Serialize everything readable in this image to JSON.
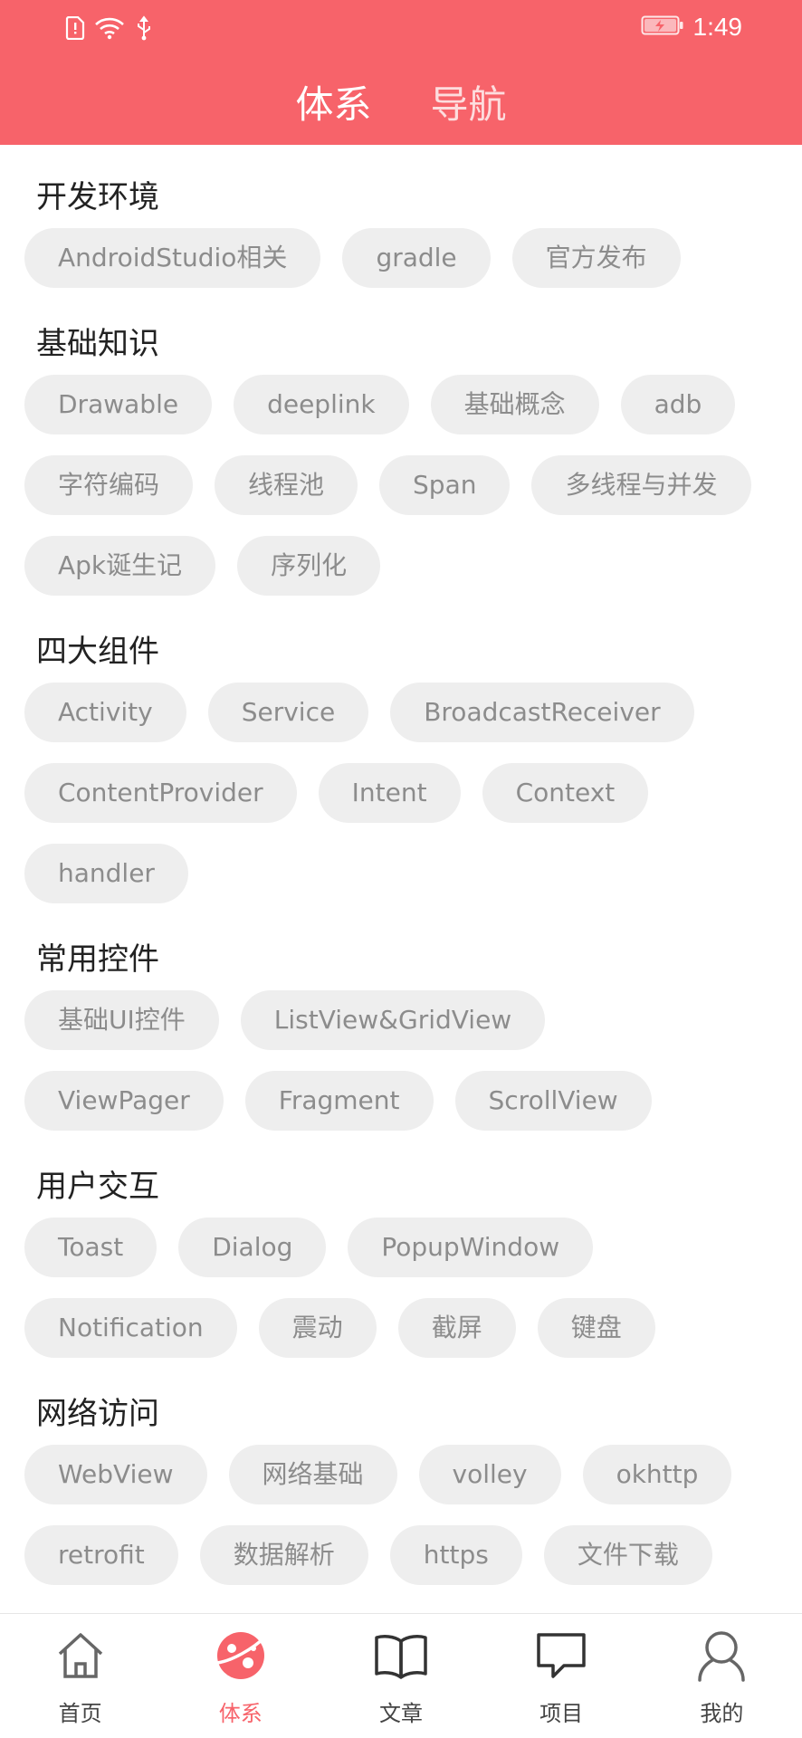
{
  "status_bar": {
    "time": "1:49",
    "icons": [
      "sim-alert-icon",
      "wifi-icon",
      "usb-icon",
      "battery-charging-icon"
    ]
  },
  "header": {
    "tabs": [
      {
        "label": "体系",
        "active": true
      },
      {
        "label": "导航",
        "active": false
      }
    ],
    "background_color": "#f7636a"
  },
  "sections": [
    {
      "title": "开发环境",
      "tags": [
        "AndroidStudio相关",
        "gradle",
        "官方发布"
      ]
    },
    {
      "title": "基础知识",
      "tags": [
        "Drawable",
        "deeplink",
        "基础概念",
        "adb",
        "字符编码",
        "线程池",
        "Span",
        "多线程与并发",
        "Apk诞生记",
        "序列化"
      ]
    },
    {
      "title": "四大组件",
      "tags": [
        "Activity",
        "Service",
        "BroadcastReceiver",
        "ContentProvider",
        "Intent",
        "Context",
        "handler"
      ]
    },
    {
      "title": "常用控件",
      "tags": [
        "基础UI控件",
        "ListView&GridView",
        "ViewPager",
        "Fragment",
        "ScrollView"
      ]
    },
    {
      "title": "用户交互",
      "tags": [
        "Toast",
        "Dialog",
        "PopupWindow",
        "Notification",
        "震动",
        "截屏",
        "键盘"
      ]
    },
    {
      "title": "网络访问",
      "tags": [
        "WebView",
        "网络基础",
        "volley",
        "okhttp",
        "retrofit",
        "数据解析",
        "https",
        "文件下载"
      ]
    }
  ],
  "bottom_nav": [
    {
      "label": "首页",
      "icon": "home-icon",
      "active": false
    },
    {
      "label": "体系",
      "icon": "system-planet-icon",
      "active": true
    },
    {
      "label": "文章",
      "icon": "book-icon",
      "active": false
    },
    {
      "label": "项目",
      "icon": "chat-bubble-icon",
      "active": false
    },
    {
      "label": "我的",
      "icon": "user-icon",
      "active": false
    }
  ],
  "colors": {
    "accent": "#f7636a",
    "chip_bg": "#eeeeee",
    "chip_text": "#8c8c8c"
  }
}
